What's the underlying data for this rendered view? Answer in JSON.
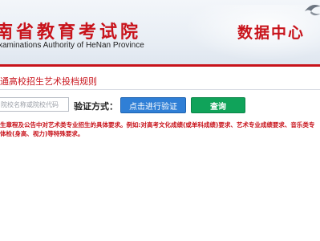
{
  "header": {
    "title": "南省教育考试院",
    "subtitle": "xaminations Authority of HeNan Province",
    "data_center": "数据中心",
    "accent_color": "#c8131b"
  },
  "section": {
    "title": "通高校招生艺术投档规则"
  },
  "search": {
    "placeholder": "院校名称或院校代码",
    "value": "",
    "verify_label": "验证方式：",
    "verify_button": "点击进行验证",
    "query_button": "查询"
  },
  "notice": {
    "line1": "生章程及公告中对艺术类专业招生的具体要求。例如:对高考文化成绩(或单科成绩)要求、艺术专业成绩要求、音乐类专",
    "line2": "体检(身高、视力)等特殊要求。"
  },
  "icons": {
    "bird": "bird-icon"
  },
  "colors": {
    "verify_button": "#2f7fd6",
    "query_button": "#10a35a"
  }
}
